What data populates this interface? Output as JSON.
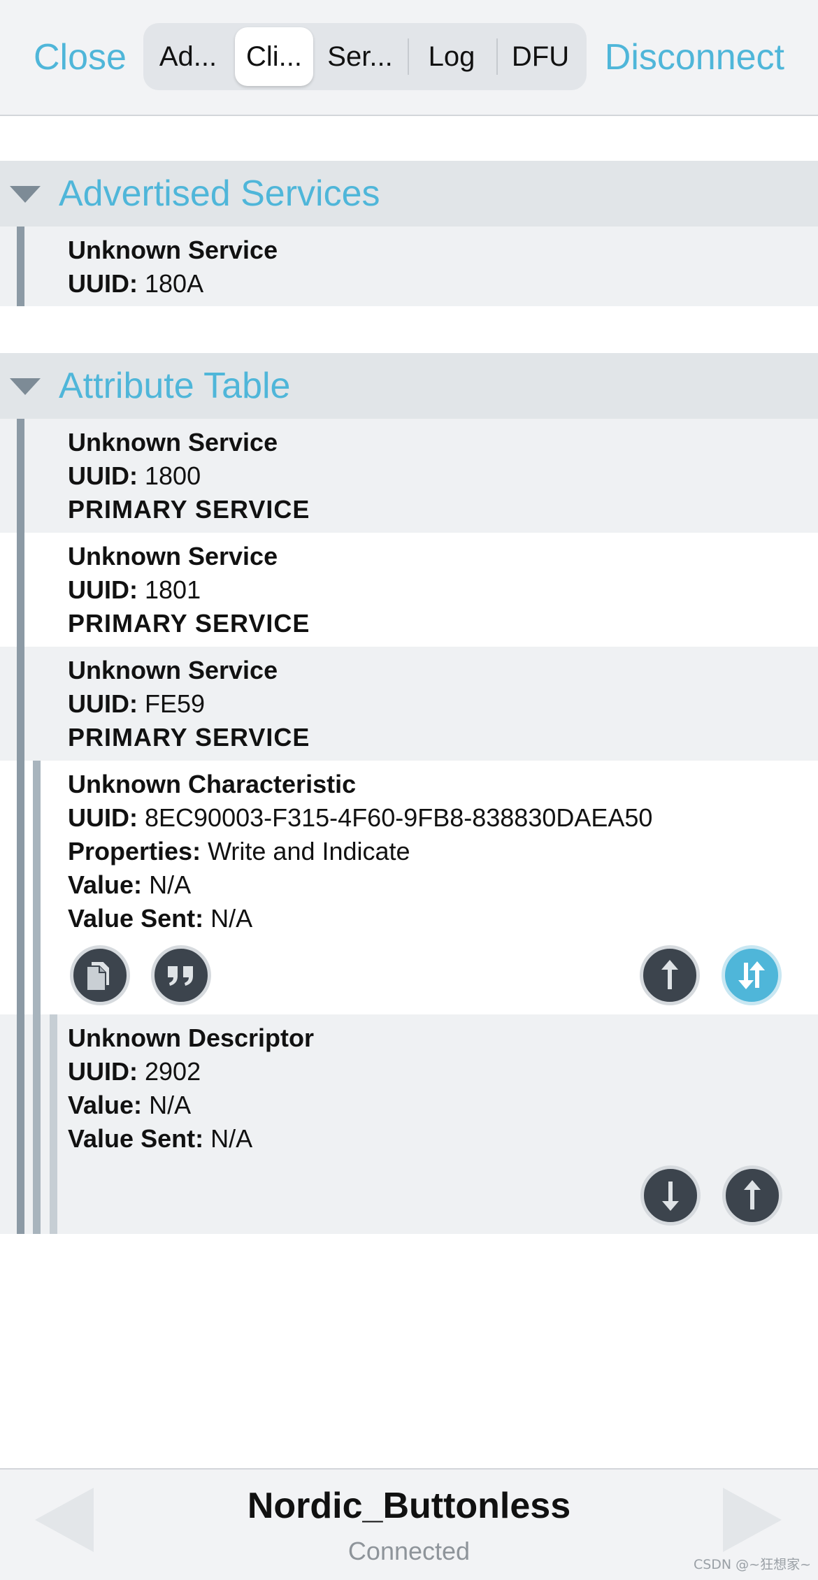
{
  "topbar": {
    "close_label": "Close",
    "disconnect_label": "Disconnect",
    "tabs": [
      {
        "label": "Ad..."
      },
      {
        "label": "Cli..."
      },
      {
        "label": "Ser..."
      },
      {
        "label": "Log"
      },
      {
        "label": "DFU"
      }
    ],
    "active_tab": "Cli..."
  },
  "advertised": {
    "title": "Advertised Services",
    "service": {
      "name": "Unknown Service",
      "uuid_key": "UUID:",
      "uuid": "180A"
    }
  },
  "attribute_table": {
    "title": "Attribute Table",
    "services": [
      {
        "name": "Unknown Service",
        "uuid_key": "UUID:",
        "uuid": "1800",
        "type": "PRIMARY SERVICE"
      },
      {
        "name": "Unknown Service",
        "uuid_key": "UUID:",
        "uuid": "1801",
        "type": "PRIMARY SERVICE"
      },
      {
        "name": "Unknown Service",
        "uuid_key": "UUID:",
        "uuid": "FE59",
        "type": "PRIMARY SERVICE"
      }
    ],
    "characteristic": {
      "name": "Unknown Characteristic",
      "uuid_key": "UUID:",
      "uuid": "8EC90003-F315-4F60-9FB8-838830DAEA50",
      "properties_key": "Properties:",
      "properties": "Write and Indicate",
      "value_key": "Value:",
      "value": "N/A",
      "value_sent_key": "Value Sent:",
      "value_sent": "N/A",
      "actions": [
        "copy-icon",
        "quote-icon",
        "write-arrow-up-icon",
        "indicate-toggle-icon"
      ]
    },
    "descriptor": {
      "name": "Unknown Descriptor",
      "uuid_key": "UUID:",
      "uuid": "2902",
      "value_key": "Value:",
      "value": "N/A",
      "value_sent_key": "Value Sent:",
      "value_sent": "N/A",
      "actions": [
        "read-arrow-down-icon",
        "write-arrow-up-icon"
      ]
    }
  },
  "bottombar": {
    "device_name": "Nordic_Buttonless",
    "status": "Connected",
    "watermark": "CSDN @~狂想家~"
  },
  "colors": {
    "accent": "#4fb6d9",
    "header_bg": "#e1e5e8",
    "row_grey": "#eff1f3",
    "icon_dark": "#3c444d"
  }
}
